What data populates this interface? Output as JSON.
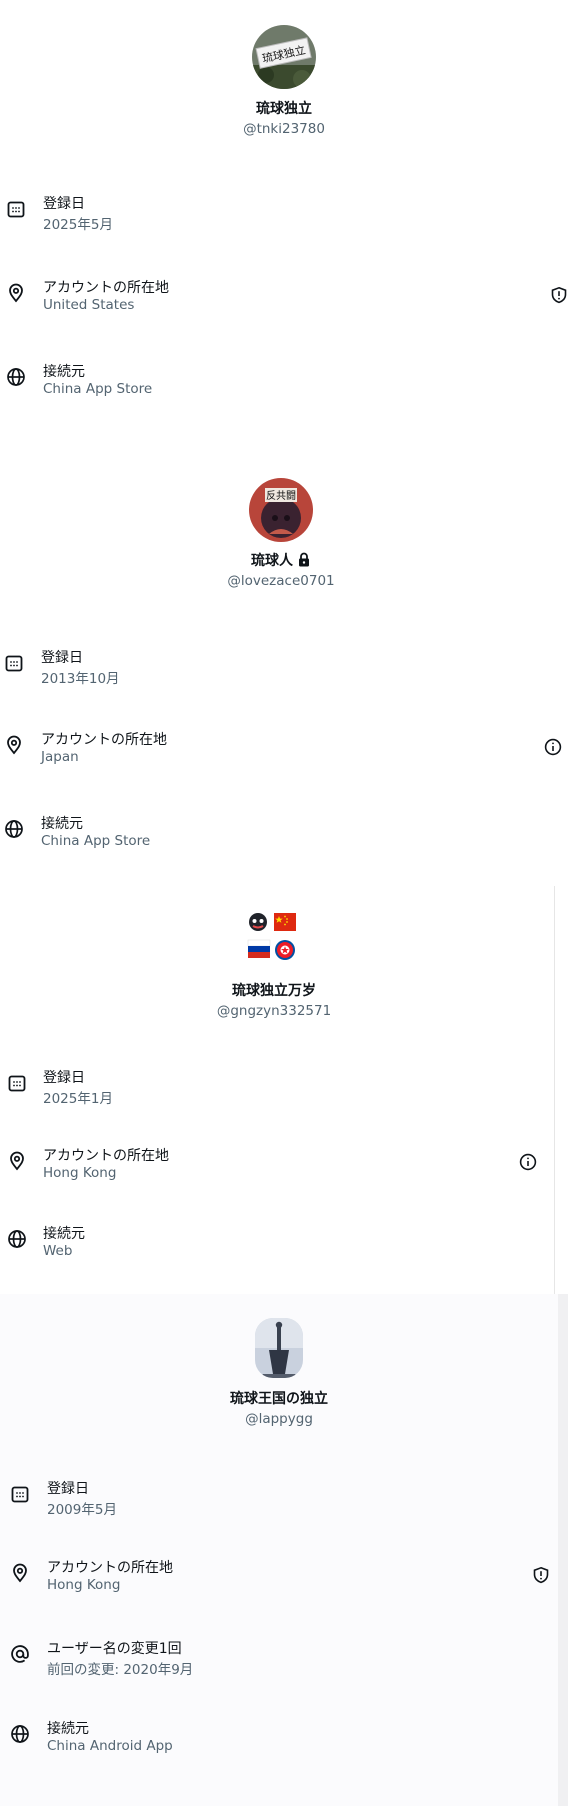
{
  "labels": {
    "joined": "登録日",
    "location": "アカウントの所在地",
    "connected_via": "接続元",
    "username_changes": "ユーザー名の変更1回"
  },
  "profiles": [
    {
      "name": "琉球独立",
      "handle": "@tnki23780",
      "avatar_sign_text": "琉球独立",
      "joined": "2025年5月",
      "location": "United States",
      "location_icon": "shield-alert-icon",
      "connected_via": "China App Store"
    },
    {
      "name": "琉球人",
      "handle": "@lovezace0701",
      "avatar_sign_text": "反共闘",
      "locked": true,
      "joined": "2013年10月",
      "location": "Japan",
      "location_icon": "info-icon",
      "connected_via": "China App Store"
    },
    {
      "name": "琉球独立万岁",
      "handle": "@gngzyn332571",
      "joined": "2025年1月",
      "location": "Hong Kong",
      "location_icon": "info-icon",
      "connected_via": "Web"
    },
    {
      "name": "琉球王国の独立",
      "handle": "@lappygg",
      "joined": "2009年5月",
      "location": "Hong Kong",
      "location_icon": "shield-alert-icon",
      "username_change_last": "前回の変更: 2020年9月",
      "connected_via": "China Android App"
    }
  ],
  "colors": {
    "primary_text": "#0f1419",
    "secondary_text": "#536471",
    "flag_china_red": "#de2910",
    "flag_star_yellow": "#ffde00"
  }
}
